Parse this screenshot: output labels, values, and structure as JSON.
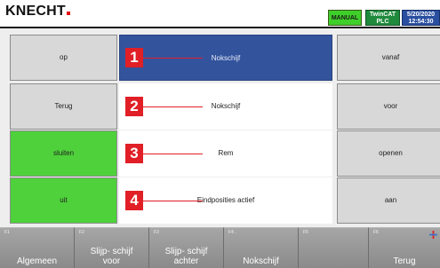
{
  "header": {
    "logo_text": "KNECHT",
    "mode_badge": "MANUAL",
    "plc_line1": "TwinCAT",
    "plc_line2": "PLC",
    "date": "5/20/2020",
    "time": "12:54:30"
  },
  "rows": [
    {
      "callout": "1",
      "left_button": "op",
      "label": "Nokschijf",
      "right_button": "vanaf"
    },
    {
      "callout": "2",
      "left_button": "Terug",
      "label": "Nokschijf",
      "right_button": "voor"
    },
    {
      "callout": "3",
      "left_button": "sluiten",
      "label": "Rem",
      "right_button": "openen"
    },
    {
      "callout": "4",
      "left_button": "uit",
      "label": "Eindposities actief",
      "right_button": "aan"
    }
  ],
  "function_keys": [
    {
      "key": "F1",
      "label": "Algemeen"
    },
    {
      "key": "F2",
      "label": "Slijp- schijf voor"
    },
    {
      "key": "F3",
      "label": "Slijp- schijf achter"
    },
    {
      "key": "F4 .",
      "label": "Nokschijf"
    },
    {
      "key": "F5",
      "label": ""
    },
    {
      "key": "F6",
      "label": "Terug"
    }
  ],
  "colors": {
    "active_label": "#33539d",
    "green_button": "#4ed13b",
    "callout_red": "#e11f26"
  }
}
